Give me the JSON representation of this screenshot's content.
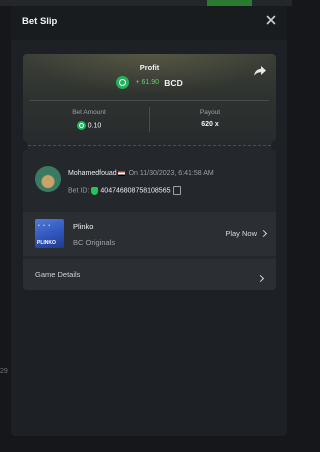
{
  "header": {
    "title": "Bet Slip"
  },
  "summary": {
    "profit_label": "Profit",
    "profit_value": "+ 61.90",
    "currency": "BCD",
    "bet_amount_label": "Bet Amount",
    "bet_amount_value": "0.10",
    "payout_label": "Payout",
    "payout_value": "620 x"
  },
  "user": {
    "name": "Mohamedfouad",
    "date": "On 11/30/2023, 6:41:58 AM",
    "bet_id_label": "Bet ID:",
    "bet_id": "404746808758108565"
  },
  "game": {
    "name": "Plinko",
    "provider": "BC Originals",
    "thumb_text": "PLINKO",
    "play_label": "Play Now"
  },
  "details": {
    "label": "Game Details"
  },
  "background": {
    "side_number": "29"
  },
  "colors": {
    "accent_green": "#21b35a",
    "profit_green": "#5cd46d"
  }
}
